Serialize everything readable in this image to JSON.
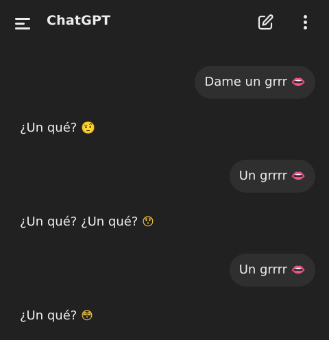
{
  "header": {
    "title": "ChatGPT",
    "menu_icon": "menu-icon",
    "new_chat_icon": "edit-icon",
    "more_icon": "more-vert-icon"
  },
  "messages": [
    {
      "role": "user",
      "text": "Dame un grrr",
      "emoji": "👄"
    },
    {
      "role": "assistant",
      "text": "¿Un qué?",
      "emoji": "🤨"
    },
    {
      "role": "user",
      "text": "Un grrrr",
      "emoji": "👄"
    },
    {
      "role": "assistant",
      "text": "¿Un qué? ¿Un qué?",
      "emoji": "😯"
    },
    {
      "role": "user",
      "text": "Un grrrr",
      "emoji": "👄"
    },
    {
      "role": "assistant",
      "text": "¿Un qué?",
      "emoji": "😳"
    }
  ],
  "colors": {
    "background": "#212121",
    "bubble": "#2f2f2f",
    "text": "#ececec"
  }
}
